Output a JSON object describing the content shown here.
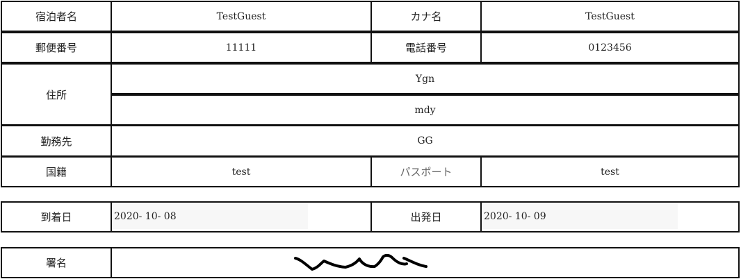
{
  "guest_name": {
    "label": "宿泊者名",
    "value": "TestGuest"
  },
  "kana_name": {
    "label": "カナ名",
    "value": "TestGuest"
  },
  "postal_code": {
    "label": "郵便番号",
    "value": "11111"
  },
  "phone": {
    "label": "電話番号",
    "value": "0123456"
  },
  "address": {
    "label": "住所",
    "line1": "Ygn",
    "line2": "mdy"
  },
  "workplace": {
    "label": "勤務先",
    "value": "GG"
  },
  "nationality": {
    "label": "国籍",
    "value": "test"
  },
  "passport": {
    "label": "パスポート",
    "value": "test"
  },
  "arrival": {
    "label": "到着日",
    "value": "2020- 10- 08"
  },
  "departure": {
    "label": "出発日",
    "value": "2020- 10- 09"
  },
  "signature": {
    "label": "署名"
  }
}
